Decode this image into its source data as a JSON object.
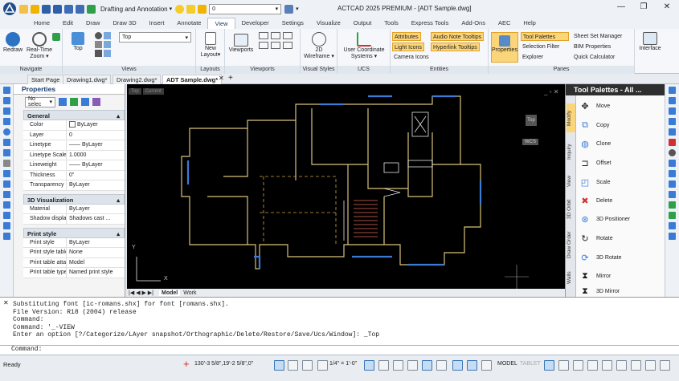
{
  "titlebar": {
    "workspace": "Drafting and Annotation",
    "layer_combo": "0",
    "title": "ACTCAD 2025 PREMIUM - [ADT Sample.dwg]"
  },
  "menu": [
    "Home",
    "Edit",
    "Draw",
    "Draw 3D",
    "Insert",
    "Annotate",
    "View",
    "Developer",
    "Settings",
    "Visualize",
    "Output",
    "Tools",
    "Express Tools",
    "Add-Ons",
    "AEC",
    "Help"
  ],
  "ribbon": {
    "navigate": {
      "title": "Navigate",
      "redraw": "Redraw",
      "realtime": "Real-Time",
      "zoom": "Zoom ▾"
    },
    "views": {
      "title": "Views",
      "top": "Top",
      "combo": "Top"
    },
    "layouts": {
      "title": "Layouts",
      "new": "New",
      "layout": "Layout▾"
    },
    "viewports": {
      "title": "Viewports",
      "label": "Viewports"
    },
    "visual": {
      "title": "Visual Styles",
      "style": "2D",
      "wire": "Wireframe ▾"
    },
    "ucs": {
      "title": "UCS",
      "label": "User Coordinate",
      "sys": "Systems ▾"
    },
    "entities": {
      "title": "Entities",
      "attributes": "Attributes",
      "audio": "Audio Note Tooltips",
      "light": "Light Icons",
      "hyperlink": "Hyperlink Tooltips",
      "camera": "Camera Icons"
    },
    "panes": {
      "title": "Panes",
      "properties": "Properties",
      "tool_palettes": "Tool Palettes",
      "selection_filter": "Selection Filter",
      "explorer": "Explorer",
      "sheet_set": "Sheet Set Manager",
      "bim": "BIM Properties",
      "quick_calc": "Quick Calculator"
    },
    "interface": "Interface"
  },
  "doc_tabs": [
    "Start Page",
    "Drawing1.dwg*",
    "Drawing2.dwg*",
    "ADT Sample.dwg*"
  ],
  "properties": {
    "title": "Properties",
    "selection": "No selec",
    "groups": [
      {
        "name": "General",
        "rows": [
          [
            "Color",
            "ByLayer"
          ],
          [
            "Layer",
            "0"
          ],
          [
            "Linetype",
            "—— ByLayer"
          ],
          [
            "Linetype Scale",
            "1.0000"
          ],
          [
            "Lineweight",
            "—— ByLayer"
          ],
          [
            "Thickness",
            "0\""
          ],
          [
            "Transparency",
            "ByLayer"
          ]
        ]
      },
      {
        "name": "3D Visualization",
        "rows": [
          [
            "Material",
            "ByLayer"
          ],
          [
            "Shadow display",
            "Shadows cast ..."
          ]
        ]
      },
      {
        "name": "Print style",
        "rows": [
          [
            "Print style",
            "ByLayer"
          ],
          [
            "Print style table",
            "None"
          ],
          [
            "Print table attac...",
            "Model"
          ],
          [
            "Print table type",
            "Named print style"
          ]
        ]
      }
    ]
  },
  "canvas": {
    "viewport_labels": [
      "Top",
      "Current"
    ],
    "viewcube": "Top",
    "wcs": "WCS",
    "axis_x": "X",
    "axis_y": "Y"
  },
  "layout_tabs": [
    "Model",
    "Work"
  ],
  "palette": {
    "title": "Tool Palettes - All ...",
    "tabs": [
      "Modify",
      "Inquiry",
      "View",
      "3D Orbit",
      "Draw Order",
      "Walls"
    ],
    "items": [
      "Move",
      "Copy",
      "Clone",
      "Offset",
      "Scale",
      "Delete",
      "3D Positioner",
      "Rotate",
      "3D Rotate",
      "Mirror",
      "3D Mirror"
    ]
  },
  "command": {
    "lines": [
      "Substituting font [ic-romans.shx] for font [romans.shx].",
      "File Version: R18 (2004) release",
      "Command:",
      "Command: '_-VIEW",
      "Enter an option [?/Categorize/LAyer snapshot/Orthographic/Delete/Restore/Save/Ucs/Window]: _Top"
    ],
    "prompt": "Command:"
  },
  "status": {
    "ready": "Ready",
    "coords": "130'-3 5/8\",19'-2 5/8\",0\"",
    "scale": "1/4\" = 1'-0\"",
    "model": "MODEL",
    "tablet": "TABLET"
  },
  "colors": {
    "accent": "#fbd57a",
    "canvas": "#000000",
    "wall": "#d9c27a",
    "window": "#3a7bd5"
  }
}
